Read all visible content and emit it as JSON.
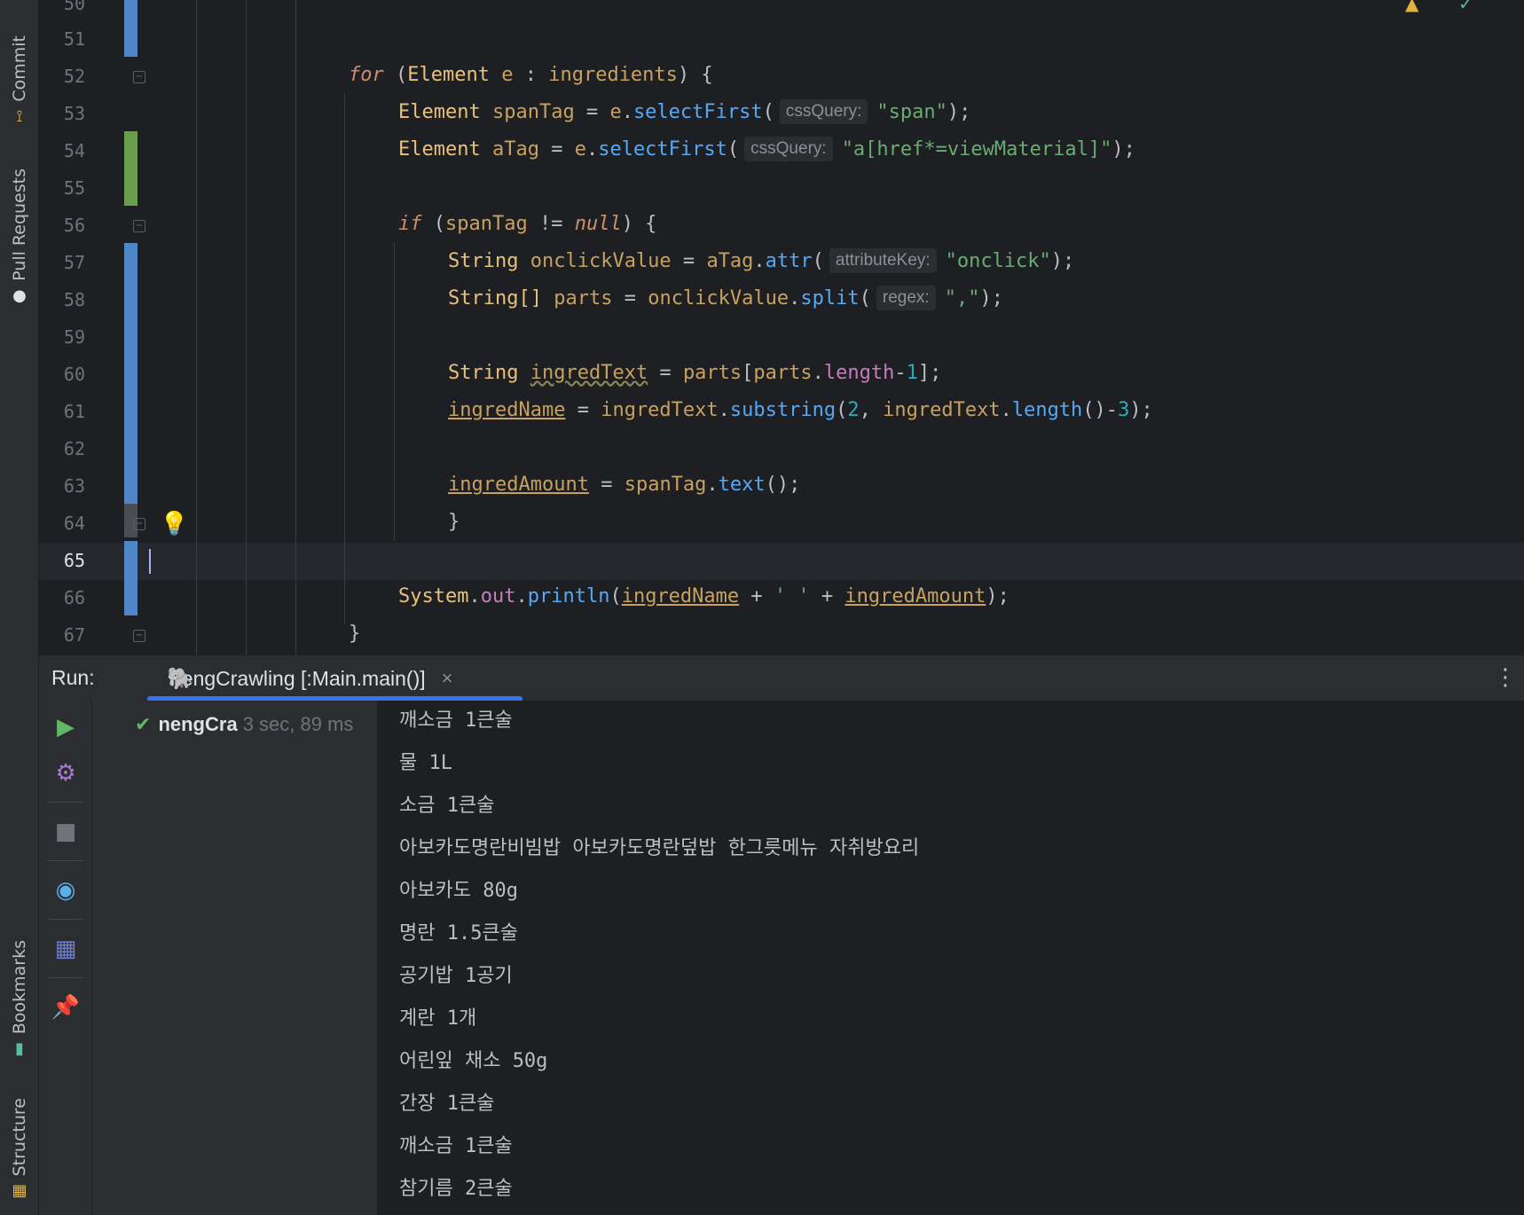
{
  "sidebar": {
    "commit": "Commit",
    "pull_requests": "Pull Requests",
    "bookmarks": "Bookmarks",
    "structure": "Structure"
  },
  "editor": {
    "line_numbers": [
      "50",
      "51",
      "52",
      "53",
      "54",
      "55",
      "56",
      "57",
      "58",
      "59",
      "60",
      "61",
      "62",
      "63",
      "64",
      "65",
      "66",
      "67"
    ],
    "hints": {
      "css_query": "cssQuery:",
      "attribute_key": "attributeKey:",
      "regex": "regex:"
    },
    "strings": {
      "span": "\"span\"",
      "a_href": "\"a[href*=viewMaterial]\"",
      "onclick": "\"onclick\"",
      "comma": "\",\"",
      "space_char": "' '"
    },
    "numbers": {
      "one": "1",
      "two": "2",
      "three": "3"
    },
    "tokens": {
      "for": "for",
      "element": "Element",
      "e": "e",
      "colon": ":",
      "ingredients": "ingredients",
      "spanTag": "spanTag",
      "aTag": "aTag",
      "selectFirst": "selectFirst",
      "if": "if",
      "null": "null",
      "string": "String",
      "onclickValue": "onclickValue",
      "attr": "attr",
      "string_array": "String[]",
      "parts": "parts",
      "split": "split",
      "ingredText": "ingredText",
      "length_field": "length",
      "ingredName": "ingredName",
      "substring": "substring",
      "length_method": "length",
      "ingredAmount": "ingredAmount",
      "text": "text",
      "system": "System",
      "out": "out",
      "println": "println"
    }
  },
  "run_panel": {
    "label": "Run:",
    "tab_title": "nengCrawling [:Main.main()]",
    "close_glyph": "×",
    "tree_item_name": "nengCra",
    "tree_item_time": "3 sec, 89 ms",
    "console_lines": [
      "깨소금 1큰술",
      "물 1L",
      "소금 1큰술",
      "아보카도명란비빔밥 아보카도명란덮밥 한그릇메뉴 자취방요리",
      "아보카도 80g",
      "명란 1.5큰술",
      "공기밥 1공기",
      "계란 1개",
      "어린잎 채소 50g",
      "간장 1큰술",
      "깨소금 1큰술",
      "참기름 2큰술"
    ]
  },
  "colors": {
    "added": "#6a9e4f",
    "modified": "#4f86c6",
    "run_green": "#5fb865",
    "gear_purple": "#a97bd4",
    "eye_blue": "#5ab0e8"
  },
  "icons": [
    "commit-icon",
    "github-icon",
    "bookmark-icon",
    "structure-icon",
    "run-icon",
    "gear-icon",
    "stop-icon",
    "eye-icon",
    "layout-icon",
    "pin-icon",
    "lightbulb-icon",
    "check-icon",
    "gradle-icon"
  ]
}
